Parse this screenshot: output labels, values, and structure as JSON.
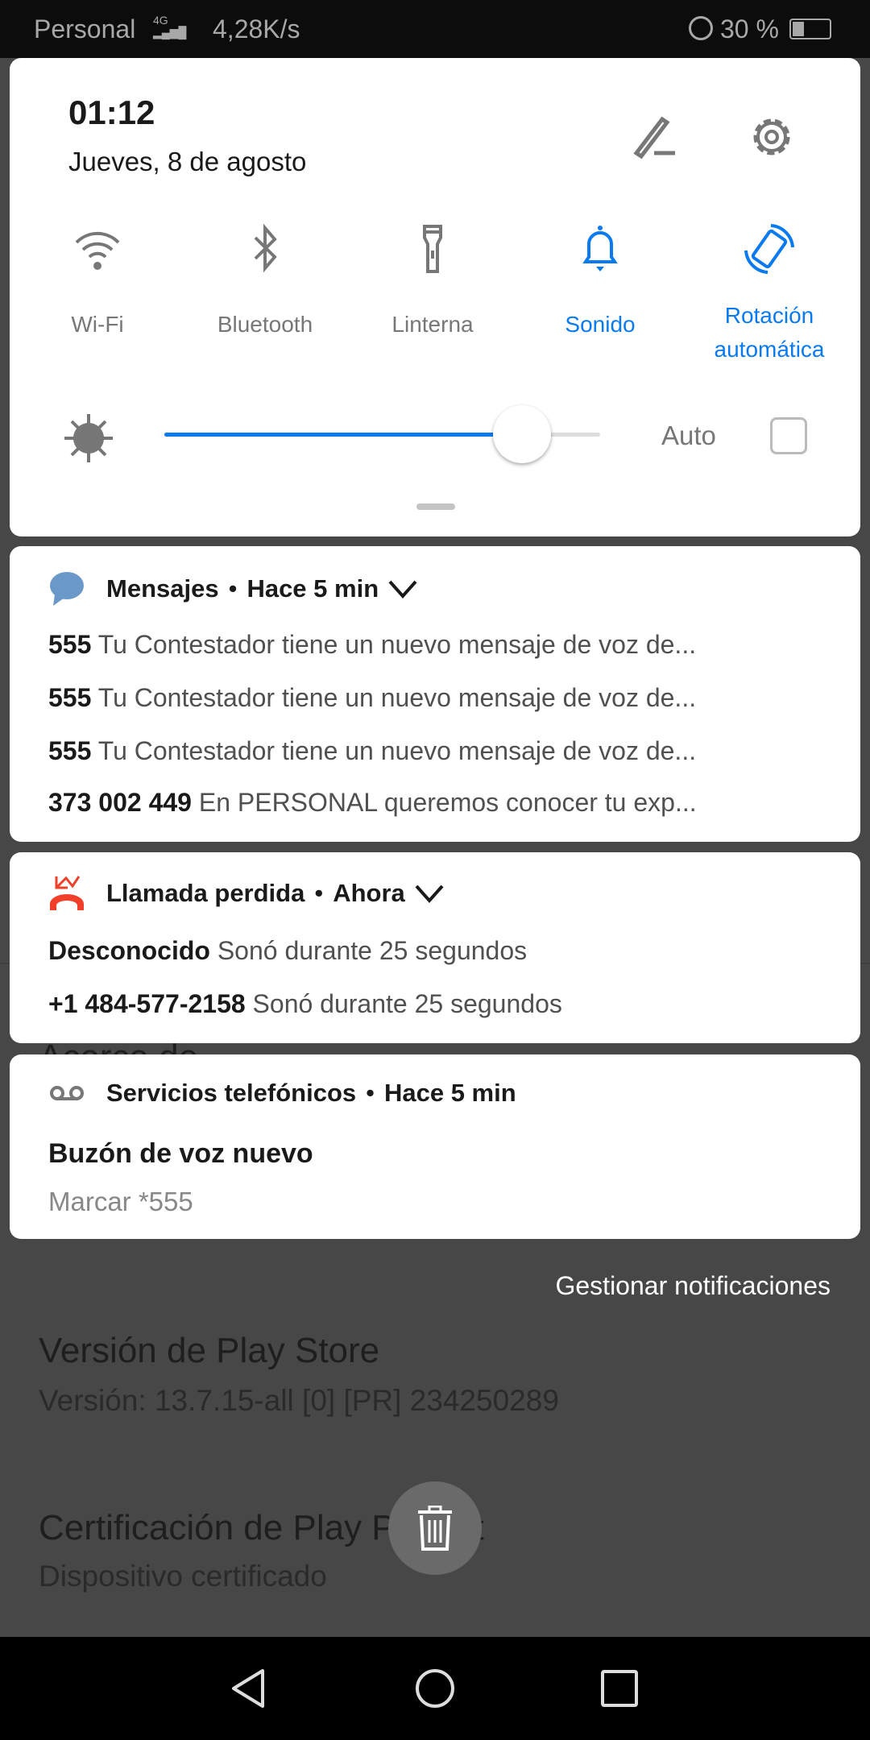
{
  "status_bar": {
    "carrier": "Personal",
    "network": "4G",
    "speed": "4,28K/s",
    "battery": "30 %",
    "battery_level": 0.3
  },
  "background": {
    "partial_heading": "Acerca de",
    "items": [
      {
        "title": "Versión de Play Store",
        "subtitle": "Versión: 13.7.15-all [0] [PR] 234250289"
      },
      {
        "title": "Certificación de Play Protect",
        "subtitle": "Dispositivo certificado"
      }
    ]
  },
  "quick_settings": {
    "time": "01:12",
    "date": "Jueves, 8 de agosto",
    "toggles": [
      {
        "label": "Wi-Fi",
        "icon": "wifi-icon",
        "active": false
      },
      {
        "label": "Bluetooth",
        "icon": "bluetooth-icon",
        "active": false
      },
      {
        "label": "Linterna",
        "icon": "flashlight-icon",
        "active": false
      },
      {
        "label": "Sonido",
        "icon": "bell-icon",
        "active": true
      },
      {
        "label": "Rotación automática",
        "icon": "rotate-icon",
        "active": true
      }
    ],
    "brightness": {
      "level": 0.82,
      "auto_label": "Auto",
      "auto_checked": false
    },
    "accent": "#0a7af0"
  },
  "notifications": [
    {
      "app": "Mensajes",
      "time": "Hace 5 min",
      "icon": "message-icon",
      "icon_color": "#6a98c9",
      "lines": [
        {
          "sender": "555",
          "text": "Tu Contestador tiene un nuevo mensaje de voz de..."
        },
        {
          "sender": "555",
          "text": "Tu Contestador tiene un nuevo mensaje de voz de..."
        },
        {
          "sender": "555",
          "text": "Tu Contestador tiene un nuevo mensaje de voz de..."
        },
        {
          "sender": "373 002 449",
          "text": "En PERSONAL queremos conocer tu exp..."
        }
      ]
    },
    {
      "app": "Llamada perdida",
      "time": "Ahora",
      "icon": "missed-call-icon",
      "icon_color": "#f0402a",
      "lines": [
        {
          "sender": "Desconocido",
          "text": "Sonó durante 25 segundos"
        },
        {
          "sender": "+1 484-577-2158",
          "text": "Sonó durante 25 segundos"
        }
      ]
    },
    {
      "app": "Servicios telefónicos",
      "time": "Hace 5 min",
      "icon": "voicemail-icon",
      "title": "Buzón de voz nuevo",
      "text": "Marcar *555"
    }
  ],
  "manage_label": "Gestionar notificaciones"
}
